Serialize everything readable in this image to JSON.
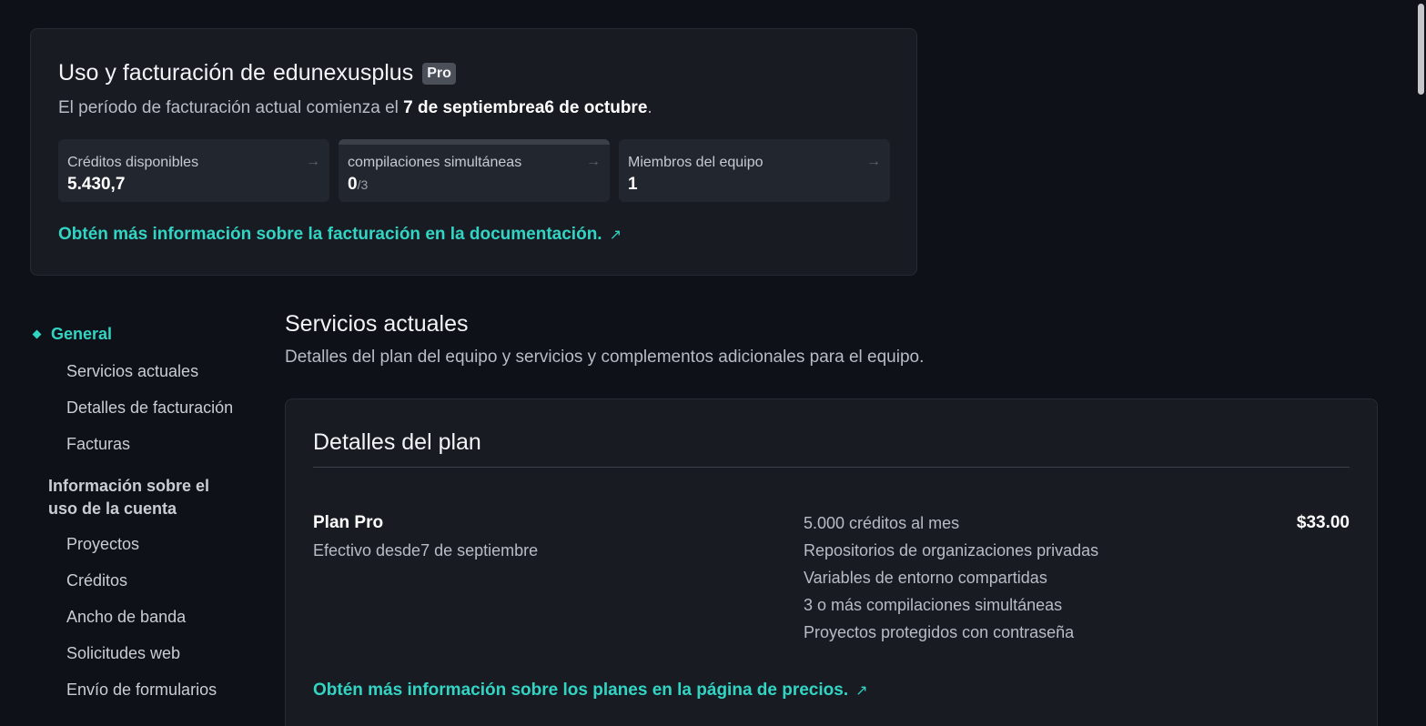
{
  "summary": {
    "title": "Uso y facturación de",
    "team_name": "edunexusplus",
    "badge": "Pro",
    "period_prefix": "El período de facturación actual comienza el",
    "period_dates": "7 de septiembrea6 de octubre",
    "period_suffix": ".",
    "stats": [
      {
        "label": "Créditos disponibles",
        "value": "5.430,7",
        "max": ""
      },
      {
        "label": "compilaciones simultáneas",
        "value": "0",
        "max": "/3"
      },
      {
        "label": "Miembros del equipo",
        "value": "1",
        "max": ""
      }
    ],
    "doc_link": "Obtén más información sobre la facturación en la documentación.",
    "arrow_icon": "→",
    "external_icon": "↗"
  },
  "sidebar": {
    "group_label": "General",
    "items_general": [
      "Servicios actuales",
      "Detalles de facturación",
      "Facturas"
    ],
    "usage_heading": "Información sobre el uso de la cuenta",
    "items_usage": [
      "Proyectos",
      "Créditos",
      "Ancho de banda",
      "Solicitudes web",
      "Envío de formularios"
    ]
  },
  "main": {
    "title": "Servicios actuales",
    "subtitle": "Detalles del plan del equipo y servicios y complementos adicionales para el equipo.",
    "plan_card": {
      "title": "Detalles del plan",
      "plan_name": "Plan Pro",
      "effective": "Efectivo desde7 de septiembre",
      "features": [
        "5.000 créditos al mes",
        "Repositorios de organizaciones privadas",
        "Variables de entorno compartidas",
        "3 o más compilaciones simultáneas",
        "Proyectos protegidos con contraseña"
      ],
      "price": "$33.00",
      "pricing_link": "Obtén más información sobre los planes en la página de precios."
    }
  },
  "colors": {
    "accent": "#32d5c4",
    "background": "#0e1117",
    "card": "#181b22"
  }
}
